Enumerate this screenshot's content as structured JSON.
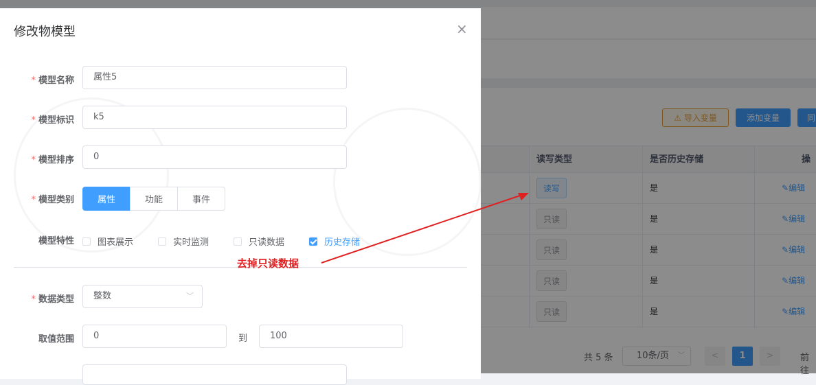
{
  "background": {
    "toolbar": {
      "import_label": "导入变量",
      "add_label": "添加变量",
      "sync_label": "同"
    },
    "table": {
      "headers": [
        "读写类型",
        "是否历史存储",
        "操作"
      ],
      "rows": [
        {
          "rw": "读写",
          "history": "是",
          "action": "编辑"
        },
        {
          "rw": "只读",
          "history": "是",
          "action": "编辑"
        },
        {
          "rw": "只读",
          "history": "是",
          "action": "编辑"
        },
        {
          "rw": "只读",
          "history": "是",
          "action": "编辑"
        },
        {
          "rw": "只读",
          "history": "是",
          "action": "编辑"
        }
      ]
    },
    "pagination": {
      "total": "共 5 条",
      "page_size": "10条/页",
      "prev": "<",
      "current": "1",
      "next": ">",
      "goto": "前往"
    }
  },
  "dialog": {
    "title": "修改物模型",
    "close": "×",
    "fields": {
      "name": {
        "label": "模型名称",
        "value": "属性5"
      },
      "key": {
        "label": "模型标识",
        "value": "k5"
      },
      "order": {
        "label": "模型排序",
        "value": "0"
      },
      "category": {
        "label": "模型类别",
        "options": [
          "属性",
          "功能",
          "事件"
        ],
        "selected": "属性"
      },
      "features": {
        "label": "模型特性",
        "options": [
          {
            "label": "图表展示",
            "checked": false
          },
          {
            "label": "实时监测",
            "checked": false
          },
          {
            "label": "只读数据",
            "checked": false
          },
          {
            "label": "历史存储",
            "checked": true
          }
        ]
      },
      "datatype": {
        "label": "数据类型",
        "value": "整数"
      },
      "range": {
        "label": "取值范围",
        "min": "0",
        "to": "到",
        "max": "100"
      }
    }
  },
  "annotation": {
    "text": "去掉只读数据",
    "color": "#e02020"
  },
  "colors": {
    "primary": "#409eff",
    "warning": "#e6a23c",
    "danger": "#f56c6c"
  }
}
